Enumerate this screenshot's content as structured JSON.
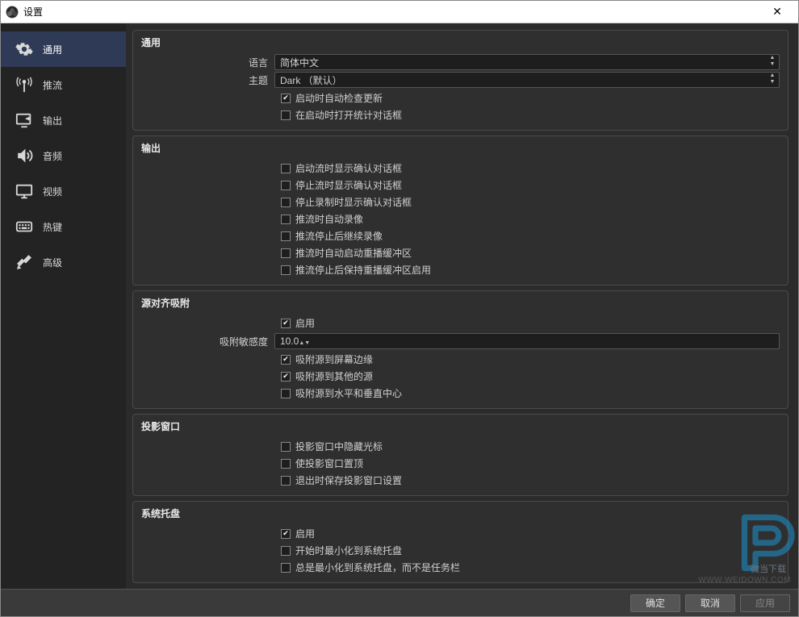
{
  "window": {
    "title": "设置"
  },
  "sidebar": {
    "items": [
      {
        "label": "通用"
      },
      {
        "label": "推流"
      },
      {
        "label": "输出"
      },
      {
        "label": "音频"
      },
      {
        "label": "视频"
      },
      {
        "label": "热键"
      },
      {
        "label": "高级"
      }
    ]
  },
  "groups": {
    "general": {
      "title": "通用",
      "language_label": "语言",
      "language_value": "简体中文",
      "theme_label": "主题",
      "theme_value": "Dark （默认）",
      "checks": [
        {
          "label": "启动时自动检查更新",
          "checked": true
        },
        {
          "label": "在启动时打开统计对话框",
          "checked": false
        }
      ]
    },
    "output": {
      "title": "输出",
      "checks": [
        {
          "label": "启动流时显示确认对话框",
          "checked": false
        },
        {
          "label": "停止流时显示确认对话框",
          "checked": false
        },
        {
          "label": "停止录制时显示确认对话框",
          "checked": false
        },
        {
          "label": "推流时自动录像",
          "checked": false
        },
        {
          "label": "推流停止后继续录像",
          "checked": false
        },
        {
          "label": "推流时自动启动重播缓冲区",
          "checked": false
        },
        {
          "label": "推流停止后保持重播缓冲区启用",
          "checked": false
        }
      ]
    },
    "snap": {
      "title": "源对齐吸附",
      "enable": {
        "label": "启用",
        "checked": true
      },
      "sensitivity_label": "吸附敏感度",
      "sensitivity_value": "10.0",
      "checks": [
        {
          "label": "吸附源到屏幕边缘",
          "checked": true
        },
        {
          "label": "吸附源到其他的源",
          "checked": true
        },
        {
          "label": "吸附源到水平和垂直中心",
          "checked": false
        }
      ]
    },
    "projector": {
      "title": "投影窗口",
      "checks": [
        {
          "label": "投影窗口中隐藏光标",
          "checked": false
        },
        {
          "label": "使投影窗口置顶",
          "checked": false
        },
        {
          "label": "退出时保存投影窗口设置",
          "checked": false
        }
      ]
    },
    "tray": {
      "title": "系统托盘",
      "enable": {
        "label": "启用",
        "checked": true
      },
      "checks": [
        {
          "label": "开始时最小化到系统托盘",
          "checked": false
        },
        {
          "label": "总是最小化到系统托盘，而不是任务栏",
          "checked": false
        }
      ]
    }
  },
  "footer": {
    "ok": "确定",
    "cancel": "取消",
    "apply": "应用"
  },
  "watermark": {
    "sub": "微当下载",
    "url": "WWW.WEIDOWN.COM"
  }
}
